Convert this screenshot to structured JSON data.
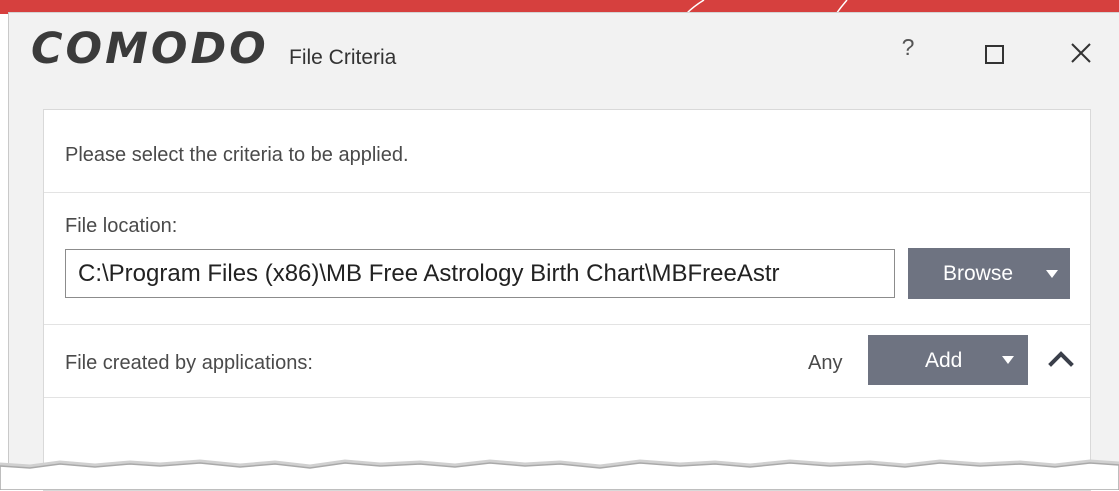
{
  "window": {
    "logo": "COMODO",
    "title": "File Criteria",
    "help_label": "?"
  },
  "content": {
    "instruction": "Please select the criteria to be applied.",
    "file_location": {
      "label": "File location:",
      "value": "C:\\Program Files (x86)\\MB Free Astrology Birth Chart\\MBFreeAstr",
      "browse_label": "Browse"
    },
    "created_by": {
      "label": "File created by applications:",
      "value": "Any",
      "add_label": "Add"
    }
  },
  "icons": {
    "maximize": "maximize-icon",
    "close": "close-icon",
    "dropdown": "chevron-down-icon",
    "collapse": "chevron-up-icon"
  },
  "colors": {
    "brand_red": "#d6403e",
    "button_grey": "#6e7381",
    "dialog_bg": "#f2f2f2",
    "panel_bg": "#ffffff",
    "text": "#444444"
  }
}
